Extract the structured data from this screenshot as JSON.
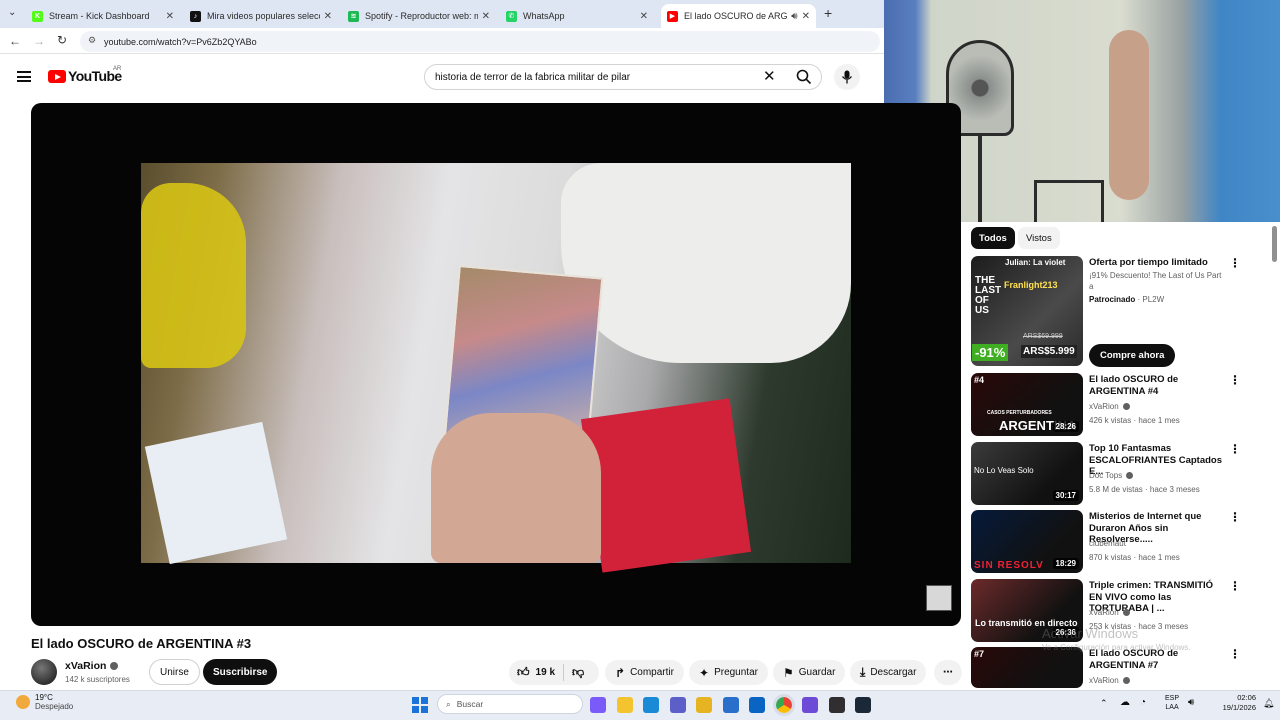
{
  "browser": {
    "tabs": [
      {
        "title": "Stream - Kick Dashboard",
        "color": "#53fc18",
        "glyph": "K"
      },
      {
        "title": "Mira videos populares seleccio",
        "color": "#111111",
        "glyph": "♪"
      },
      {
        "title": "Spotify - Reproductor web: mú",
        "color": "#1db954",
        "glyph": "≋"
      },
      {
        "title": "WhatsApp",
        "color": "#25d366",
        "glyph": "✆"
      },
      {
        "title": "El lado OSCURO de ARGEN",
        "color": "#ff0000",
        "glyph": "▶"
      }
    ],
    "url": "youtube.com/watch?v=Pv6Zb2QYABo"
  },
  "youtube": {
    "logo_text": "YouTube",
    "region": "AR",
    "search_value": "historia de terror de la fabrica militar de pilar"
  },
  "video": {
    "title": "El lado OSCURO de ARGENTINA #3",
    "channel": "xVaRion",
    "subscribers": "142 k suscriptores",
    "join_label": "Unirse",
    "subscribe_label": "Suscribirse",
    "likes": "19 k",
    "share_label": "Compartir",
    "ask_label": "Preguntar",
    "save_label": "Guardar",
    "download_label": "Descargar"
  },
  "sidebar": {
    "chips": [
      "Todos",
      "Vistos"
    ],
    "ad": {
      "title": "Oferta por tiempo limitado",
      "desc": "¡91% Descuento! The Last of Us Part",
      "desc2": "a",
      "sponsor": "Patrocinado",
      "sponsor_brand": "PL2W",
      "cta": "Compre ahora",
      "thumb_discount": "-91%",
      "thumb_price": "ARS$5.999",
      "thumb_old_price": "ARS$69.999",
      "thumb_logo": "THE LAST OF US",
      "thumb_overlay": "Julian: La violet",
      "thumb_overlay2": "Franlight213"
    },
    "videos": [
      {
        "title": "El lado OSCURO de ARGENTINA #4",
        "channel": "xVaRion",
        "verified": true,
        "meta": "426 k vistas · hace 1 mes",
        "duration": "28:26",
        "badge": "#4",
        "thumb_text": "ARGENTINA",
        "thumb_small": "CASOS PERTURBADORES",
        "bg": "#2a0808"
      },
      {
        "title": "Top 10 Fantasmas ESCALOFRIANTES Captados E...",
        "channel": "Doc Tops",
        "verified": true,
        "meta": "5.8 M de vistas · hace 3 meses",
        "duration": "30:17",
        "badge": "",
        "thumb_text": "No Lo Veas Solo",
        "thumb_small": "",
        "bg": "#3b3b3b"
      },
      {
        "title": "Misterios de Internet que Duraron Años sin Resolverse.....",
        "channel": "clubemaut",
        "verified": false,
        "meta": "870 k vistas · hace 1 mes",
        "duration": "18:29",
        "badge": "",
        "thumb_text": "SIN RESOLV",
        "thumb_small": "",
        "bg": "#061a3a"
      },
      {
        "title": "Triple crimen: TRANSMITIÓ EN VIVO como las TORTURABA | ...",
        "channel": "xVaRion",
        "verified": true,
        "meta": "253 k vistas · hace 3 meses",
        "duration": "26:36",
        "badge": "",
        "thumb_text": "Lo transmitió en directo",
        "thumb_small": "",
        "bg": "#6b2a2a"
      },
      {
        "title": "El lado OSCURO de ARGENTINA #7",
        "channel": "xVaRion",
        "verified": true,
        "meta": "",
        "duration": "",
        "badge": "#7",
        "thumb_text": "",
        "thumb_small": "",
        "bg": "#2a0808"
      }
    ]
  },
  "watermark": {
    "line1": "Activar Windows",
    "line2": "Ve a Configuración para activar Windows."
  },
  "taskbar": {
    "weather_temp": "19°C",
    "weather_desc": "Despejado",
    "search_placeholder": "Buscar",
    "lang1": "ESP",
    "lang2": "LAA",
    "time": "02:06",
    "date": "19/1/2026"
  }
}
